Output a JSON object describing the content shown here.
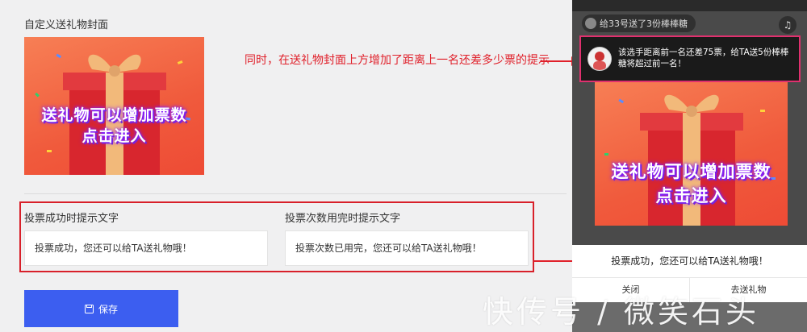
{
  "cover": {
    "title": "自定义送礼物封面",
    "line1": "送礼物可以增加票数",
    "line2": "点击进入"
  },
  "tips": {
    "success_label": "投票成功时提示文字",
    "success_value": "投票成功，您还可以给TA送礼物哦！",
    "exhausted_label": "投票次数用完时提示文字",
    "exhausted_value": "投票次数已用完，您还可以给TA送礼物哦！"
  },
  "save_button": {
    "label": "保存",
    "icon": "save-icon"
  },
  "annotation": "同时，在送礼物封面上方增加了距离上一名还差多少票的提示",
  "phone": {
    "gift_message": "给33号送了3份棒棒糖",
    "music_icon": "music-icon",
    "notice_text": "该选手距离前一名还差75票，给TA送5份棒棒糖将超过前一名！",
    "gift_line1": "送礼物可以增加票数",
    "gift_line2": "点击进入",
    "success_text": "投票成功，您还可以给TA送礼物哦！",
    "close_label": "关闭",
    "go_gift_label": "去送礼物"
  },
  "watermark": "快传号 / 微笑石头",
  "colors": {
    "accent_blue": "#3c5ef0",
    "annotation_red": "#e0202a",
    "highlight_pink": "#e0306e",
    "gift_orange": "#f05a3c"
  }
}
